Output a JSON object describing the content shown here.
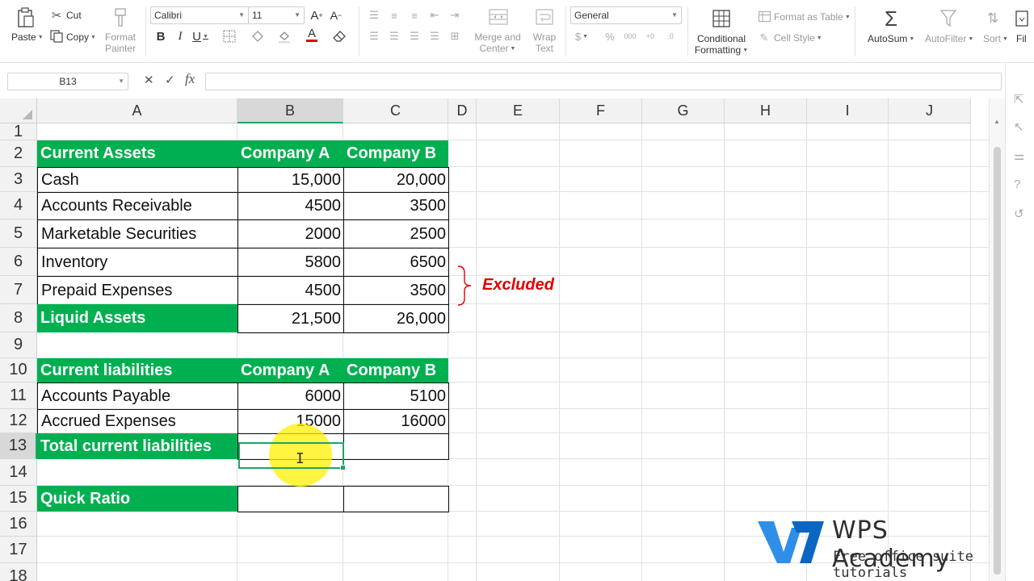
{
  "ribbon": {
    "paste": "Paste",
    "cut": "Cut",
    "copy": "Copy",
    "format_painter": [
      "Format",
      "Painter"
    ],
    "font_name": "Calibri",
    "font_size": "11",
    "merge_center": [
      "Merge and",
      "Center"
    ],
    "wrap_text": [
      "Wrap",
      "Text"
    ],
    "number_format": "General",
    "conditional_formatting": [
      "Conditional",
      "Formatting"
    ],
    "format_as_table": "Format as Table",
    "cell_style": "Cell Style",
    "autosum": "AutoSum",
    "autofilter": "AutoFilter",
    "sort": "Sort",
    "fill": "Fil"
  },
  "formula_bar": {
    "name_box": "B13",
    "fx": "fx",
    "value": ""
  },
  "columns": [
    "A",
    "B",
    "C",
    "D",
    "E",
    "F",
    "G",
    "H",
    "I",
    "J"
  ],
  "rows": [
    "1",
    "2",
    "3",
    "4",
    "5",
    "6",
    "7",
    "8",
    "9",
    "10",
    "11",
    "12",
    "13",
    "14",
    "15",
    "16",
    "17",
    "18"
  ],
  "sheet": {
    "assets_header": [
      "Current Assets",
      "Company A",
      "Company B"
    ],
    "assets": [
      [
        "Cash",
        "15,000",
        "20,000"
      ],
      [
        "Accounts Receivable",
        "4500",
        "3500"
      ],
      [
        "Marketable Securities",
        "2000",
        "2500"
      ],
      [
        "Inventory",
        "5800",
        "6500"
      ],
      [
        "Prepaid Expenses",
        "4500",
        "3500"
      ]
    ],
    "liquid_assets": [
      "Liquid Assets",
      "21,500",
      "26,000"
    ],
    "liab_header": [
      "Current liabilities",
      "Company A",
      "Company B"
    ],
    "liabilities": [
      [
        "Accounts Payable",
        "6000",
        "5100"
      ],
      [
        "Accrued Expenses",
        "15000",
        "16000"
      ]
    ],
    "total_liab": "Total current liabilities",
    "quick_ratio": "Quick Ratio",
    "annotation": "Excluded"
  },
  "watermark": {
    "title": "WPS Academy",
    "subtitle": "Free office suite tutorials"
  },
  "colors": {
    "header_green": "#00b050",
    "selection_green": "#21a366",
    "annotation_red": "#e00000",
    "highlight_yellow": "#fff000"
  }
}
